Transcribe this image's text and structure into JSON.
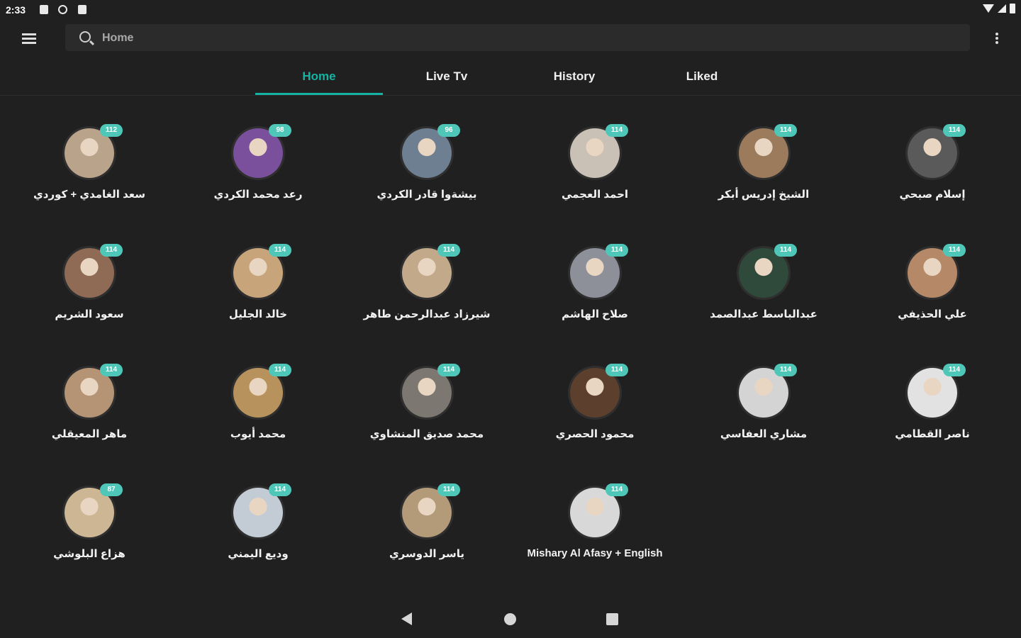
{
  "status_bar": {
    "time": "2:33"
  },
  "search": {
    "placeholder": "Home"
  },
  "tabs": [
    {
      "label": "Home",
      "active": true
    },
    {
      "label": "Live Tv",
      "active": false
    },
    {
      "label": "History",
      "active": false
    },
    {
      "label": "Liked",
      "active": false
    }
  ],
  "accent_color": "#14b3a3",
  "reciters": [
    {
      "name": "سعد الغامدي + كوردي",
      "count": "112",
      "color": "#b9a38a"
    },
    {
      "name": "رعد محمد الكردي",
      "count": "98",
      "color": "#7a4f9b"
    },
    {
      "name": "بيشةوا قادر الكردي",
      "count": "96",
      "color": "#6f7f92"
    },
    {
      "name": "احمد العجمي",
      "count": "114",
      "color": "#c9c1b5"
    },
    {
      "name": "الشيخ إدريس أبكر",
      "count": "114",
      "color": "#9b7b5c"
    },
    {
      "name": "إسلام صبحي",
      "count": "114",
      "color": "#5a5a5a"
    },
    {
      "name": "سعود الشريم",
      "count": "114",
      "color": "#8f6b55"
    },
    {
      "name": "خالد الجليل",
      "count": "114",
      "color": "#c8a47a"
    },
    {
      "name": "شيرزاد عبدالرحمن طاهر",
      "count": "114",
      "color": "#c2a98a"
    },
    {
      "name": "صلاح الهاشم",
      "count": "114",
      "color": "#8d9099"
    },
    {
      "name": "عبدالباسط عبدالصمد",
      "count": "114",
      "color": "#2f4a3b"
    },
    {
      "name": "علي الحذيفي",
      "count": "114",
      "color": "#b58968"
    },
    {
      "name": "ماهر المعيقلي",
      "count": "114",
      "color": "#b49474"
    },
    {
      "name": "محمد أيوب",
      "count": "114",
      "color": "#b7925c"
    },
    {
      "name": "محمد صديق المنشاوي",
      "count": "114",
      "color": "#7c7770"
    },
    {
      "name": "محمود الحصري",
      "count": "114",
      "color": "#5c3f2c"
    },
    {
      "name": "مشاري العفاسي",
      "count": "114",
      "color": "#d4d4d4"
    },
    {
      "name": "ناصر القطامي",
      "count": "114",
      "color": "#e2e2e2"
    },
    {
      "name": "هزاع البلوشي",
      "count": "87",
      "color": "#cdb693"
    },
    {
      "name": "وديع اليمني",
      "count": "114",
      "color": "#c3ccd4"
    },
    {
      "name": "ياسر الدوسري",
      "count": "114",
      "color": "#b39a78"
    },
    {
      "name": "Mishary Al Afasy + English",
      "count": "114",
      "color": "#d8d8d8"
    }
  ]
}
